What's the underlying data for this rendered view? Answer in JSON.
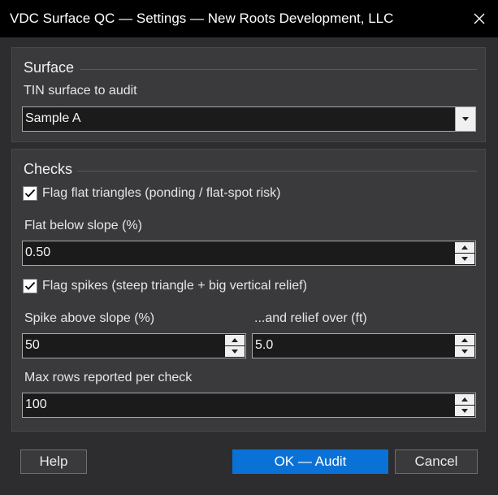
{
  "window": {
    "title": "VDC Surface QC — Settings — New Roots Development, LLC"
  },
  "surface": {
    "group_title": "Surface",
    "label": "TIN surface to audit",
    "selected": "Sample A"
  },
  "checks": {
    "group_title": "Checks",
    "flat_checkbox": {
      "label": "Flag flat triangles (ponding / flat-spot risk)",
      "checked": true
    },
    "flat_slope": {
      "label": "Flat below slope (%)",
      "value": "0.50"
    },
    "spike_checkbox": {
      "label": "Flag spikes (steep triangle + big vertical relief)",
      "checked": true
    },
    "spike_slope": {
      "label": "Spike above slope (%)",
      "value": "50"
    },
    "relief": {
      "label": "...and relief over (ft)",
      "value": "5.0"
    },
    "max_rows": {
      "label": "Max rows reported per check",
      "value": "100"
    }
  },
  "buttons": {
    "help": "Help",
    "ok": "OK — Audit",
    "cancel": "Cancel"
  },
  "colors": {
    "accent": "#0a72d6",
    "background": "#2d2d30",
    "titlebar": "#000000"
  }
}
